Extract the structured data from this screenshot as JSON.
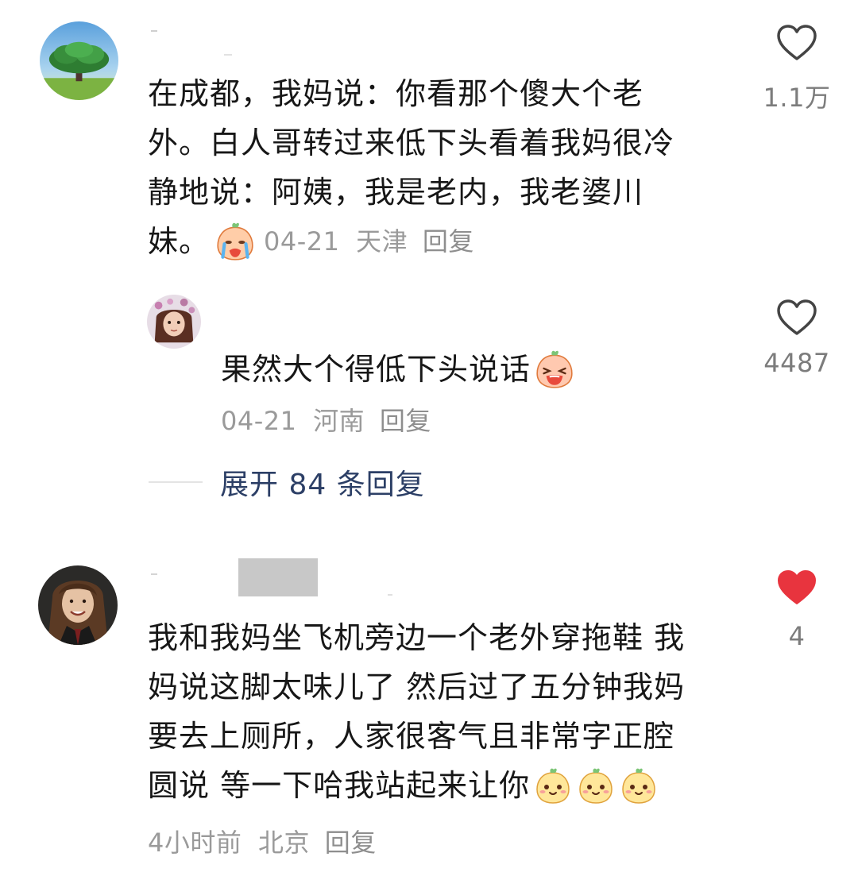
{
  "comments": [
    {
      "text": "在成都，我妈说：你看那个傻大个老外。白人哥转过来低下头看着我妈很冷静地说：阿姨，我是老内，我老婆川妹。",
      "lines": [
        "在成都，我妈说：你看那个傻大个老",
        "外。白人哥转过来低下头看着我妈很冷",
        "静地说：阿姨，我是老内，我老婆川",
        "妹。"
      ],
      "emoji": "crying-face-emoji",
      "date": "04-21",
      "location": "天津",
      "reply_label": "回复",
      "likes": "1.1万",
      "liked": false,
      "reply": {
        "text": "果然大个得低下头说话",
        "emoji": "laughing-face-emoji",
        "date": "04-21",
        "location": "河南",
        "reply_label": "回复",
        "likes": "4487",
        "liked": false
      },
      "expand_label": "展开 84 条回复"
    },
    {
      "text": "我和我妈坐飞机旁边一个老外穿拖鞋 我妈说这脚太味儿了 然后过了五分钟我妈要去上厕所，人家很客气且非常字正腔圆说 等一下哈我站起来让你",
      "lines": [
        "我和我妈坐飞机旁边一个老外穿拖鞋 我",
        "妈说这脚太味儿了 然后过了五分钟我妈",
        "要去上厕所，人家很客气且非常字正腔",
        "圆说 等一下哈我站起来让你"
      ],
      "emoji": "smiling-face-emoji",
      "emoji_count": 3,
      "time": "4小时前",
      "location": "北京",
      "reply_label": "回复",
      "likes": "4",
      "liked": true
    }
  ],
  "colors": {
    "like_active": "#e8343e",
    "like_inactive": "#444444",
    "meta_gray": "#9a9a9a",
    "expand_blue": "#2c3f66"
  }
}
